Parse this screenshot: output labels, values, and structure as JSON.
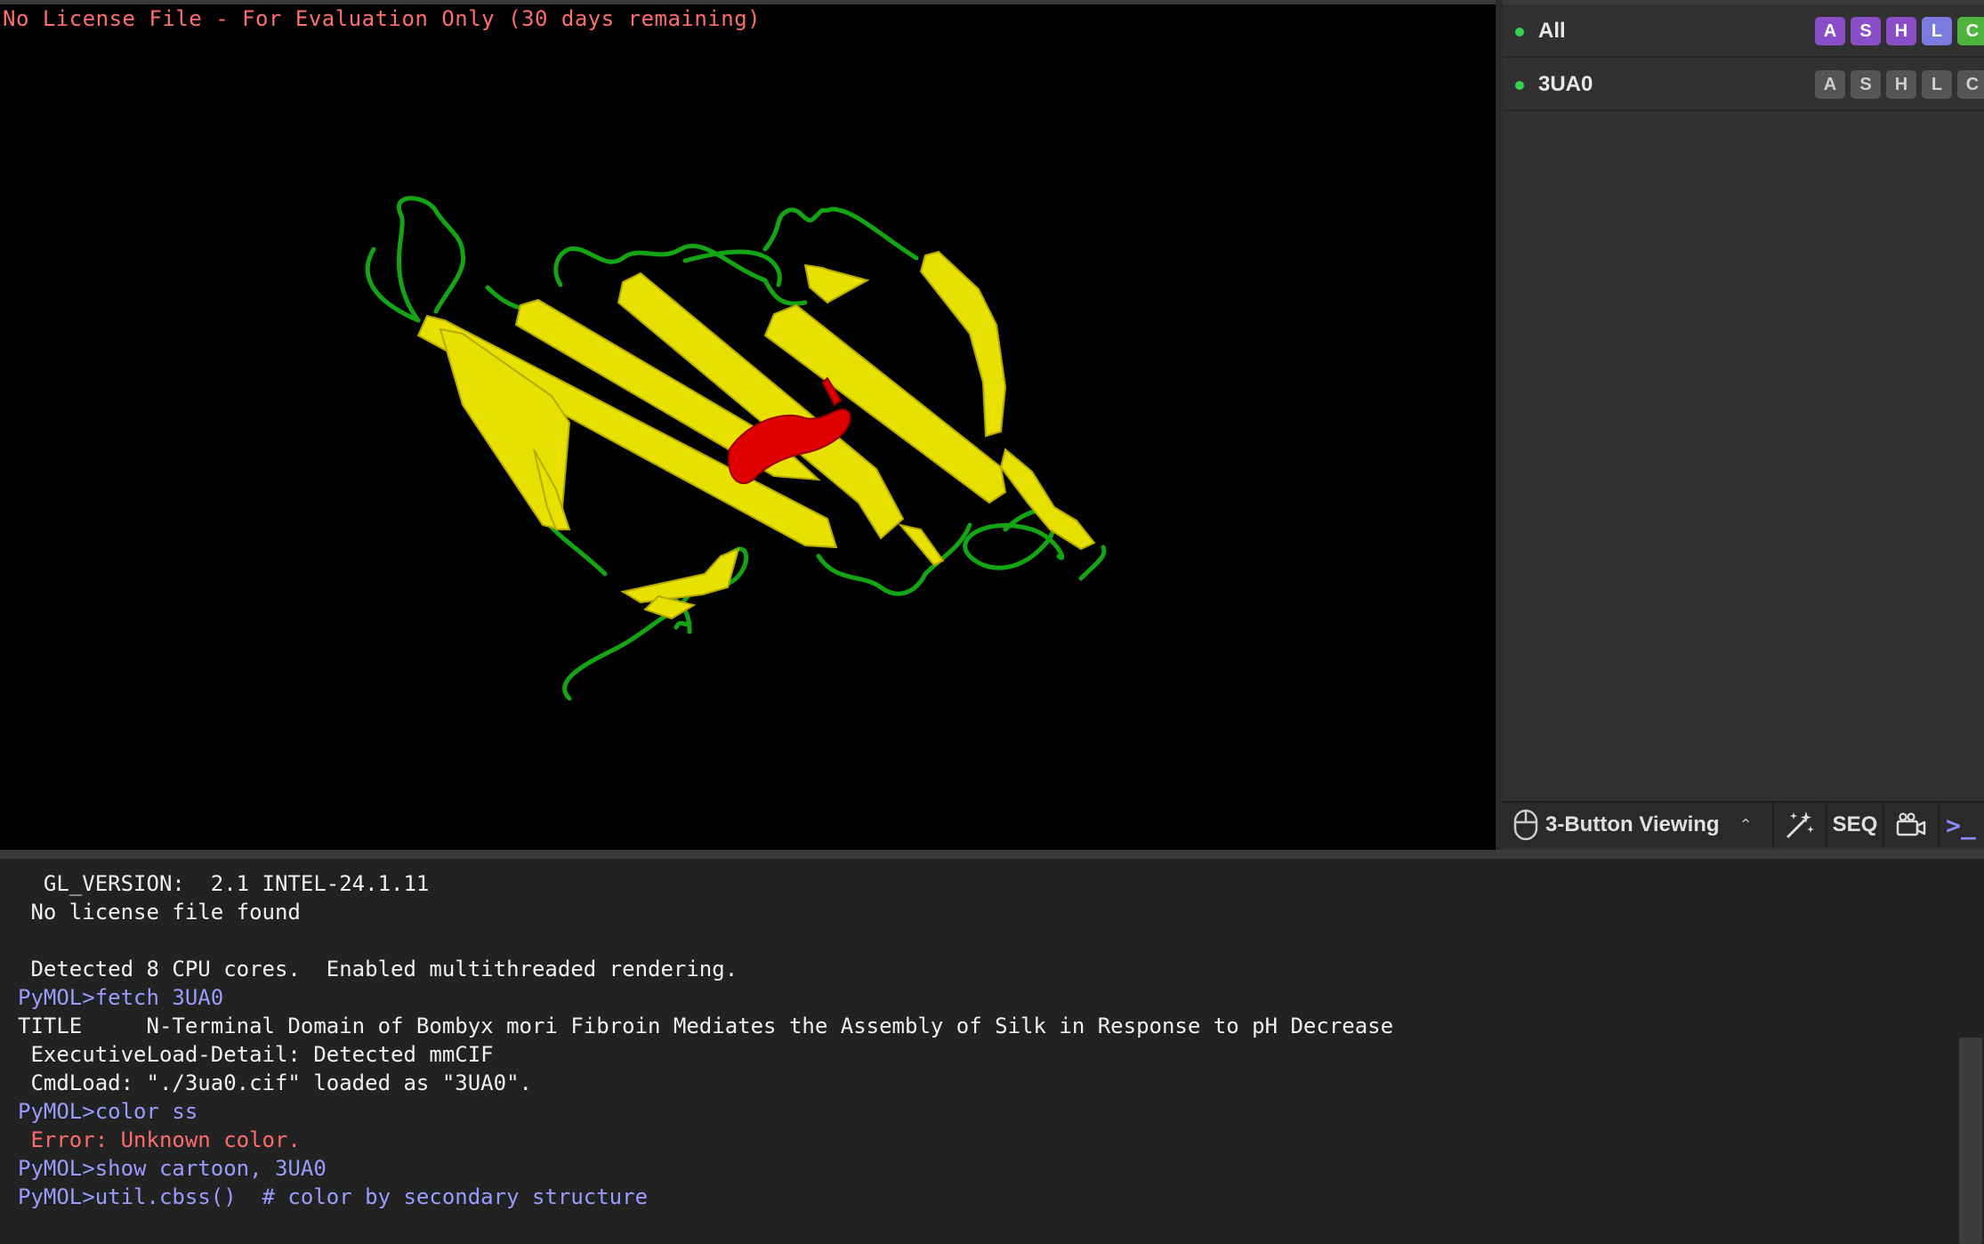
{
  "viewport": {
    "license_text": "No License File - For Evaluation Only (30 days remaining)"
  },
  "objects": [
    {
      "name": "All",
      "buttons": [
        "A",
        "S",
        "H",
        "L",
        "C"
      ]
    },
    {
      "name": "3UA0",
      "buttons": [
        "A",
        "S",
        "H",
        "L",
        "C"
      ]
    }
  ],
  "toolbar": {
    "mouse_mode": "3-Button Viewing",
    "seq_label": "SEQ",
    "cmd_label": ">_"
  },
  "console": {
    "lines": [
      {
        "text": "  GL_VERSION:  2.1 INTEL-24.1.11",
        "type": "output"
      },
      {
        "text": " No license file found",
        "type": "output"
      },
      {
        "text": "",
        "type": "output"
      },
      {
        "text": " Detected 8 CPU cores.  Enabled multithreaded rendering.",
        "type": "output"
      },
      {
        "text": "PyMOL>fetch 3UA0",
        "type": "command"
      },
      {
        "text": "TITLE     N-Terminal Domain of Bombyx mori Fibroin Mediates the Assembly of Silk in Response to pH Decrease",
        "type": "output"
      },
      {
        "text": " ExecutiveLoad-Detail: Detected mmCIF",
        "type": "output"
      },
      {
        "text": " CmdLoad: \"./3ua0.cif\" loaded as \"3UA0\".",
        "type": "output"
      },
      {
        "text": "PyMOL>color ss",
        "type": "command"
      },
      {
        "text": " Error: Unknown color.",
        "type": "error"
      },
      {
        "text": "PyMOL>show cartoon, 3UA0",
        "type": "command"
      },
      {
        "text": "PyMOL>util.cbss()  # color by secondary structure",
        "type": "command"
      }
    ]
  },
  "colors": {
    "sheet": "#e8e000",
    "helix": "#e00000",
    "loop": "#18a818"
  }
}
